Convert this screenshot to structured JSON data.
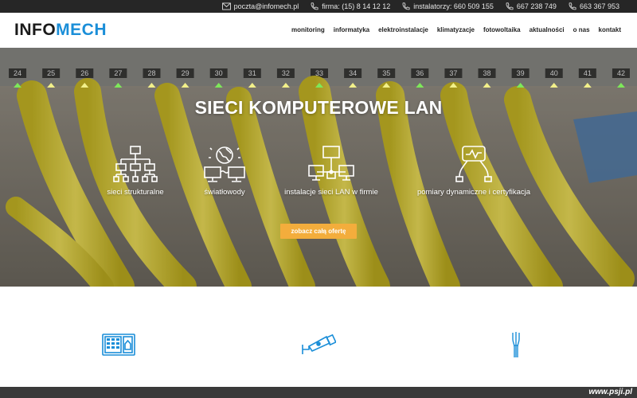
{
  "topbar": {
    "email": "poczta@infomech.pl",
    "firma": "firma: (15) 8 14 12 12",
    "instalatorzy": "instalatorzy: 660 509 155",
    "phone2": "667 238 749",
    "phone3": "663 367 953"
  },
  "logo": {
    "part1": "INFO",
    "part2": "MECH"
  },
  "nav": {
    "items": [
      "monitoring",
      "informatyka",
      "elektroinstalacje",
      "klimatyzacje",
      "fotowoltaika",
      "aktualności",
      "o nas",
      "kontakt"
    ]
  },
  "hero": {
    "title": "SIECI KOMPUTEROWE LAN",
    "port_numbers": [
      "24",
      "25",
      "26",
      "27",
      "28",
      "29",
      "30",
      "31",
      "32",
      "33",
      "34",
      "35",
      "36",
      "37",
      "38",
      "39",
      "40",
      "41",
      "42"
    ],
    "features": [
      {
        "label": "sieci strukturalne",
        "icon": "network-tree-icon"
      },
      {
        "label": "światłowody",
        "icon": "fiber-globe-icon"
      },
      {
        "label": "instalacje sieci LAN w firmie",
        "icon": "lan-computers-icon"
      },
      {
        "label": "pomiary dynamiczne i certyfikacja",
        "icon": "cable-tester-icon"
      }
    ],
    "cta": "zobacz całą ofertę"
  },
  "services": [
    {
      "icon": "intercom-panel-icon"
    },
    {
      "icon": "cctv-camera-icon"
    },
    {
      "icon": "cable-wires-icon"
    }
  ],
  "footer": {
    "watermark": "www.psji.pl"
  },
  "colors": {
    "brand_blue": "#1a8ed8",
    "cta_orange": "#f3ad3c",
    "topbar": "#262626"
  }
}
